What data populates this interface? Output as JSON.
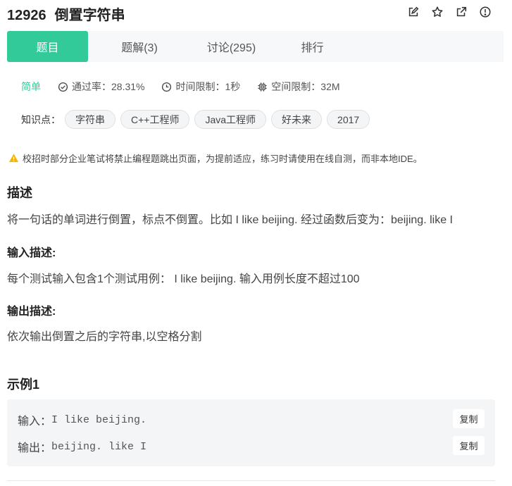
{
  "problem": {
    "id": "12926",
    "title": "倒置字符串"
  },
  "header_icons": [
    "edit-icon",
    "star-icon",
    "external-link-icon",
    "info-icon"
  ],
  "tabs": [
    {
      "label": "题目",
      "active": true
    },
    {
      "label": "题解(3)",
      "active": false
    },
    {
      "label": "讨论(295)",
      "active": false
    },
    {
      "label": "排行",
      "active": false
    }
  ],
  "meta": {
    "difficulty": "简单",
    "pass_rate": "通过率：28.31%",
    "time_limit": "时间限制：1秒",
    "space_limit": "空间限制：32M"
  },
  "knowledge": {
    "label": "知识点：",
    "tags": [
      "字符串",
      "C++工程师",
      "Java工程师",
      "好未来",
      "2017"
    ]
  },
  "notice": "校招时部分企业笔试将禁止编程题跳出页面，为提前适应，练习时请使用在线自测，而非本地IDE。",
  "description": {
    "heading": "描述",
    "text": "将一句话的单词进行倒置，标点不倒置。比如 I like beijing. 经过函数后变为：beijing. like I"
  },
  "input_desc": {
    "heading": "输入描述:",
    "text": "每个测试输入包含1个测试用例： I like beijing. 输入用例长度不超过100"
  },
  "output_desc": {
    "heading": "输出描述:",
    "text": "依次输出倒置之后的字符串,以空格分割"
  },
  "example": {
    "heading": "示例1",
    "input_label": "输入：",
    "input_value": "I like beijing.",
    "output_label": "输出：",
    "output_value": "beijing. like I",
    "copy_label": "复制"
  },
  "colors": {
    "accent": "#32ca99",
    "warning": "#f5b400"
  }
}
